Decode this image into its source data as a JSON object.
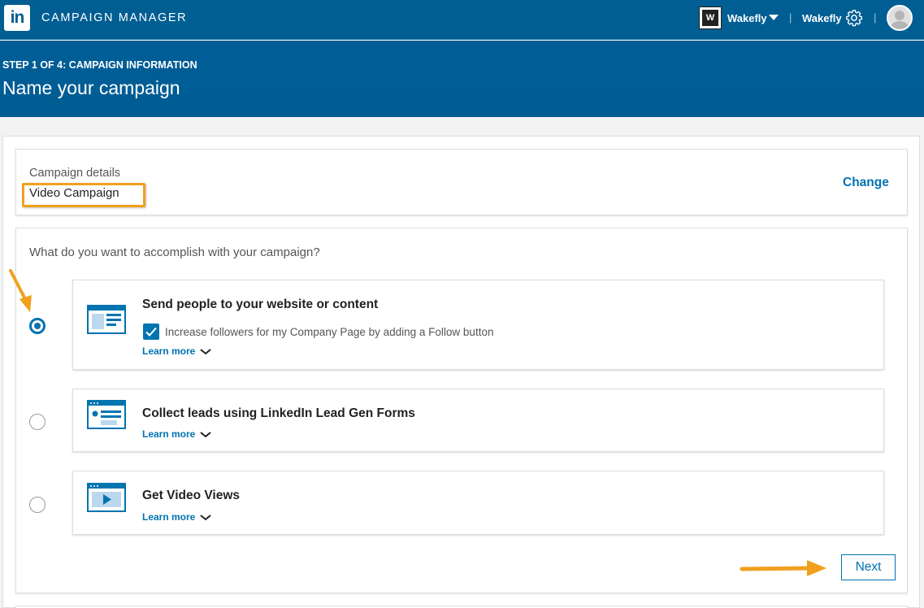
{
  "nav": {
    "logo_text": "in",
    "app_title": "CAMPAIGN MANAGER",
    "account_logo_text": "W",
    "account_name": "Wakefly",
    "separator": "|",
    "user_name": "Wakefly"
  },
  "header": {
    "step_label": "STEP 1 OF 4: CAMPAIGN INFORMATION",
    "title": "Name your campaign"
  },
  "details": {
    "label": "Campaign details",
    "value": "Video Campaign",
    "change_label": "Change"
  },
  "objective": {
    "question": "What do you want to accomplish with your campaign?",
    "options": [
      {
        "title": "Send people to your website or content",
        "selected": true,
        "checkbox_label": "Increase followers for my Company Page by adding a Follow button",
        "checkbox_checked": true,
        "learn_more": "Learn more",
        "icon": "website-icon"
      },
      {
        "title": "Collect leads using LinkedIn Lead Gen Forms",
        "selected": false,
        "learn_more": "Learn more",
        "icon": "lead-form-icon"
      },
      {
        "title": "Get Video Views",
        "selected": false,
        "learn_more": "Learn more",
        "icon": "video-icon"
      }
    ]
  },
  "actions": {
    "next_label": "Next"
  },
  "colors": {
    "brand_blue": "#005e93",
    "link_blue": "#0073b1",
    "annotation_orange": "#f1a01e"
  }
}
